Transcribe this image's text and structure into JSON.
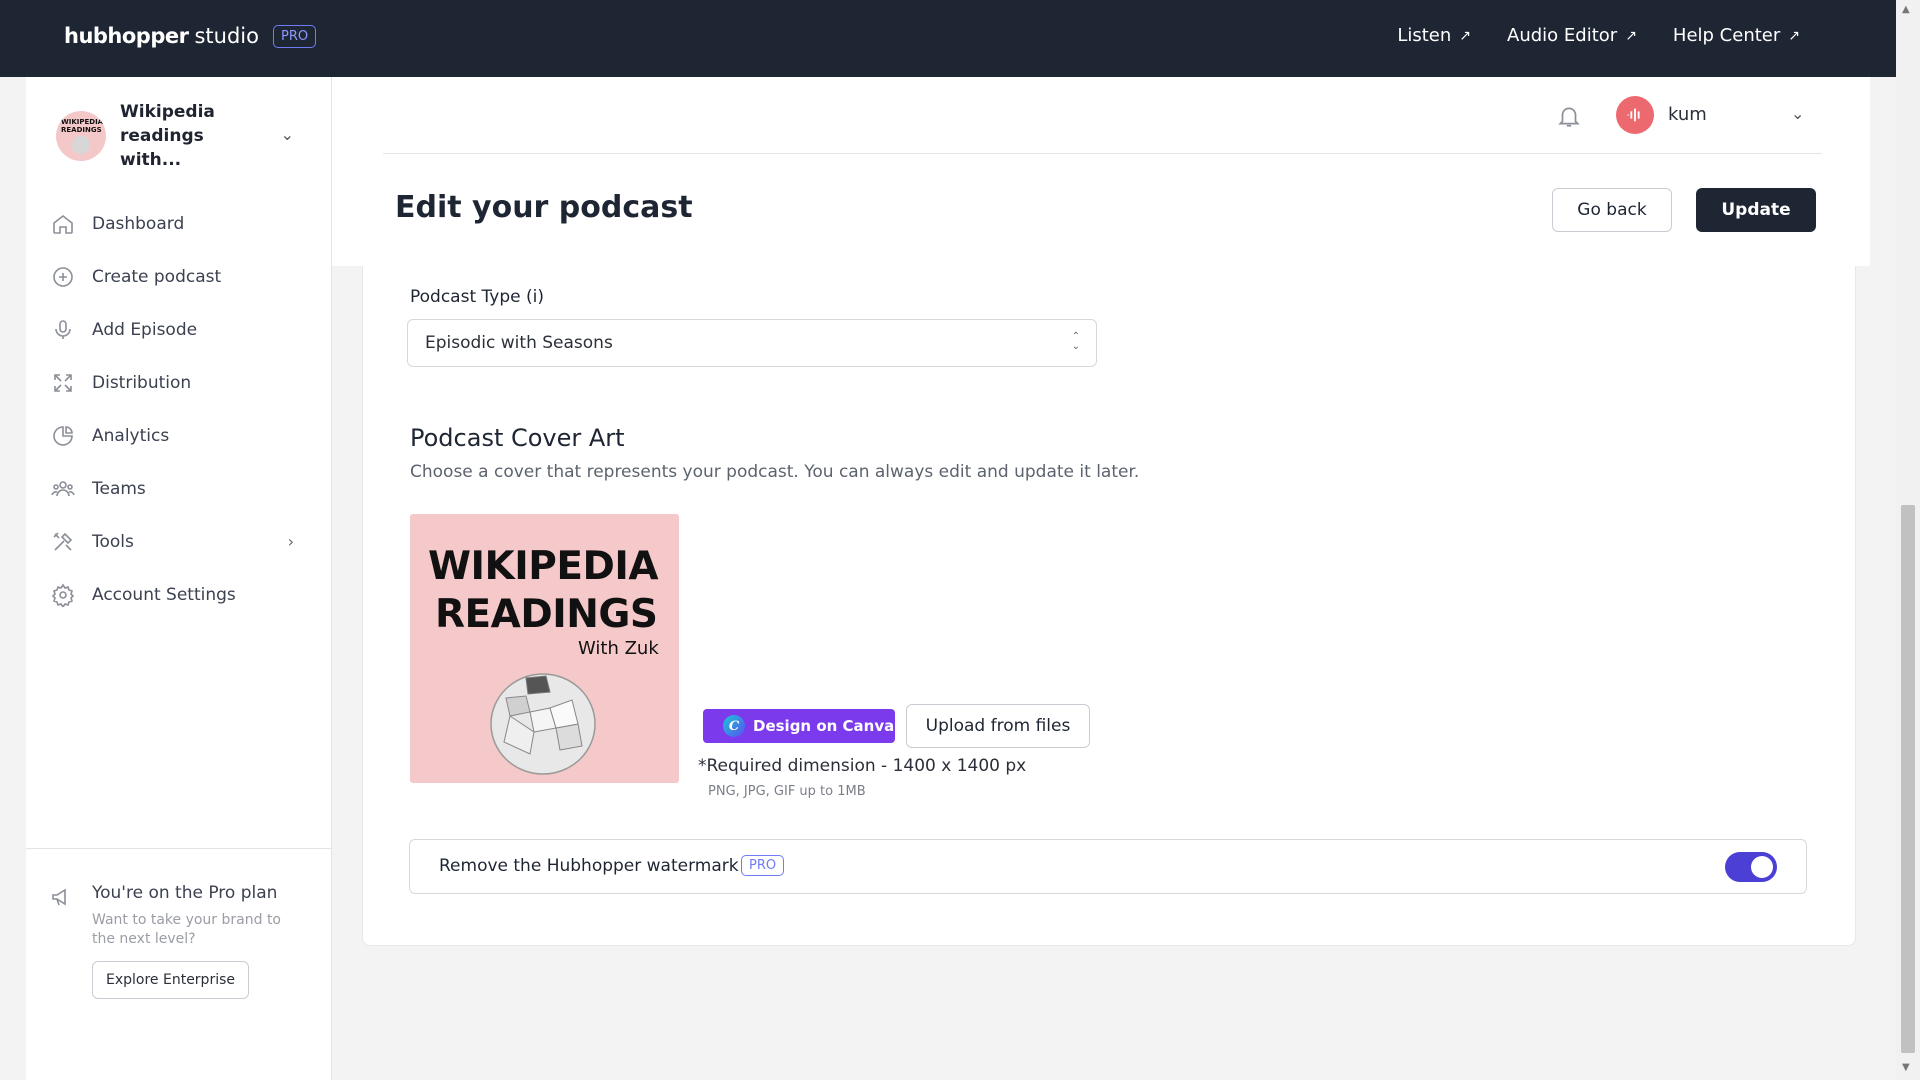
{
  "topbar": {
    "brand_name": "hubhopper",
    "brand_studio": "studio",
    "pro_badge": "PRO",
    "links": [
      {
        "label": "Listen",
        "icon": "external-arrow-icon"
      },
      {
        "label": "Audio Editor",
        "icon": "external-arrow-icon"
      },
      {
        "label": "Help Center",
        "icon": "external-arrow-icon"
      }
    ]
  },
  "sidebar": {
    "podcast_title": "Wikipedia readings with...",
    "podcast_avatar_text": "WIKIPEDIA READINGS",
    "items": [
      {
        "label": "Dashboard",
        "icon": "home-icon"
      },
      {
        "label": "Create podcast",
        "icon": "plus-circle-icon"
      },
      {
        "label": "Add Episode",
        "icon": "microphone-icon"
      },
      {
        "label": "Distribution",
        "icon": "expand-icon"
      },
      {
        "label": "Analytics",
        "icon": "pie-chart-icon"
      },
      {
        "label": "Teams",
        "icon": "users-icon"
      },
      {
        "label": "Tools",
        "icon": "tools-icon"
      },
      {
        "label": "Account Settings",
        "icon": "gear-icon"
      }
    ],
    "plan": {
      "title": "You're on the Pro plan",
      "subtitle": "Want to take your brand to the next level?",
      "button": "Explore Enterprise"
    }
  },
  "header": {
    "user_name": "kum",
    "title": "Edit your podcast",
    "go_back": "Go back",
    "update": "Update"
  },
  "form": {
    "podcast_type_label": "Podcast Type (i)",
    "podcast_type_value": "Episodic with Seasons",
    "cover_title": "Podcast Cover Art",
    "cover_subtitle": "Choose a cover that represents your podcast. You can always edit and update it later.",
    "cover_art": {
      "line1": "WIKIPEDIA",
      "line2": "READINGS",
      "line3": "With Zuk"
    },
    "canva_button": "Design on Canva",
    "upload_button": "Upload from files",
    "required_dimension": "*Required dimension - 1400 x 1400 px",
    "file_types": "PNG, JPG, GIF up to 1MB",
    "watermark_label": "Remove the Hubhopper watermark",
    "watermark_badge": "PRO",
    "watermark_enabled": true
  },
  "colors": {
    "topbar": "#1e2533",
    "accent": "#4b3fd6",
    "canva": "#7c3aed",
    "cover_bg": "#f5c9ca"
  }
}
